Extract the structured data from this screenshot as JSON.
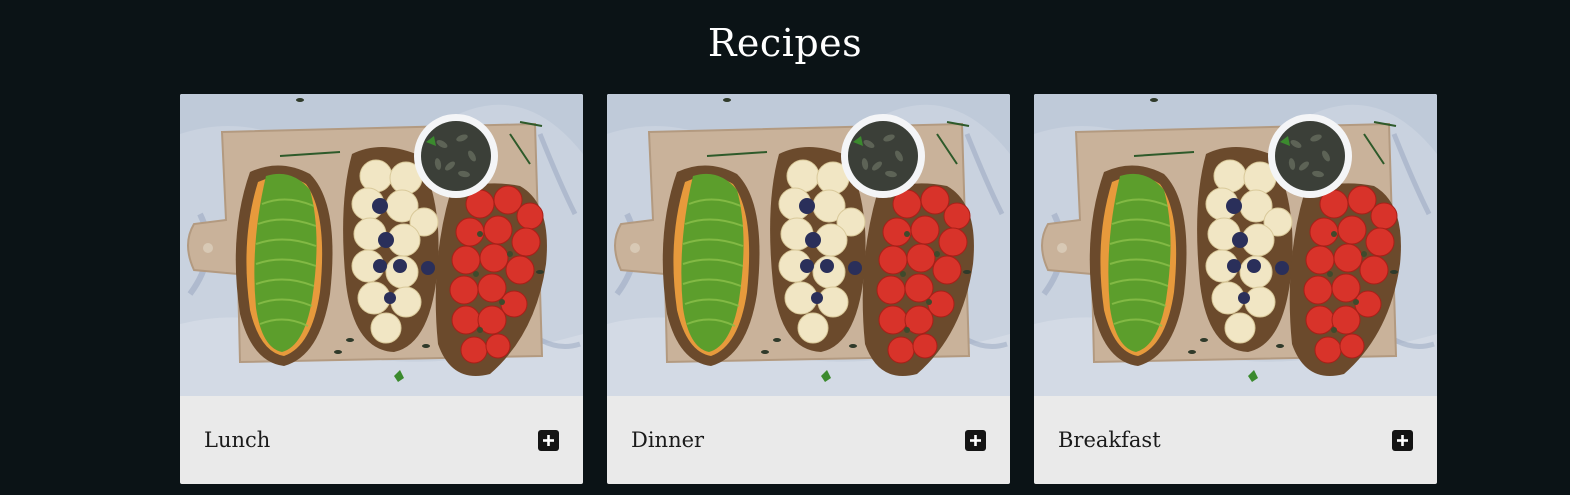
{
  "page": {
    "title": "Recipes"
  },
  "cards": [
    {
      "label": "Lunch",
      "image": "avocado-banana-tomato-toast-photo",
      "action_icon": "plus-icon"
    },
    {
      "label": "Dinner",
      "image": "avocado-banana-tomato-toast-photo",
      "action_icon": "plus-icon"
    },
    {
      "label": "Breakfast",
      "image": "avocado-banana-tomato-toast-photo",
      "action_icon": "plus-icon"
    }
  ],
  "colors": {
    "background": "#0b1316",
    "card_footer": "#eaeaea",
    "button": "#141414",
    "title": "#ffffff"
  }
}
